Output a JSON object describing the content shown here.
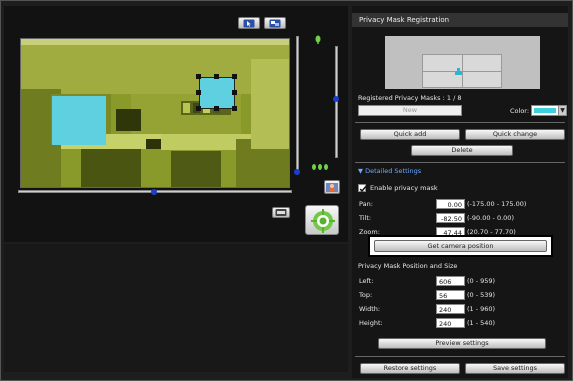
{
  "panel": {
    "title": "Privacy Mask Registration",
    "registered_label": "Registered Privacy Masks : 1 / 8",
    "mask_name_placeholder": "New",
    "color_label": "Color:",
    "color_value": "#3fd0e0",
    "quick_add": "Quick add",
    "quick_change": "Quick change",
    "delete": "Delete"
  },
  "detailed": {
    "header": "Detailed Settings",
    "enable_label": "Enable privacy mask",
    "enable_checked": true,
    "pan": {
      "label": "Pan:",
      "value": "0.00",
      "range": "(-175.00 - 175.00)"
    },
    "tilt": {
      "label": "Tilt:",
      "value": "-82.50",
      "range": "(-90.00 - 0.00)"
    },
    "zoom": {
      "label": "Zoom:",
      "value": "47.44",
      "range": "(20.70 - 77.70)"
    },
    "get_position": "Get camera position",
    "pos_size_header": "Privacy Mask Position and Size",
    "left": {
      "label": "Left:",
      "value": "606",
      "range": "(0 - 959)"
    },
    "top": {
      "label": "Top:",
      "value": "56",
      "range": "(0 - 539)"
    },
    "width": {
      "label": "Width:",
      "value": "240",
      "range": "(1 - 960)"
    },
    "height": {
      "label": "Height:",
      "value": "240",
      "range": "(1 - 540)"
    },
    "preview": "Preview settings"
  },
  "footer": {
    "restore": "Restore settings",
    "save": "Save settings"
  },
  "colors": {
    "mask": "#5fd0e0",
    "accent_highlight": "#000000"
  }
}
